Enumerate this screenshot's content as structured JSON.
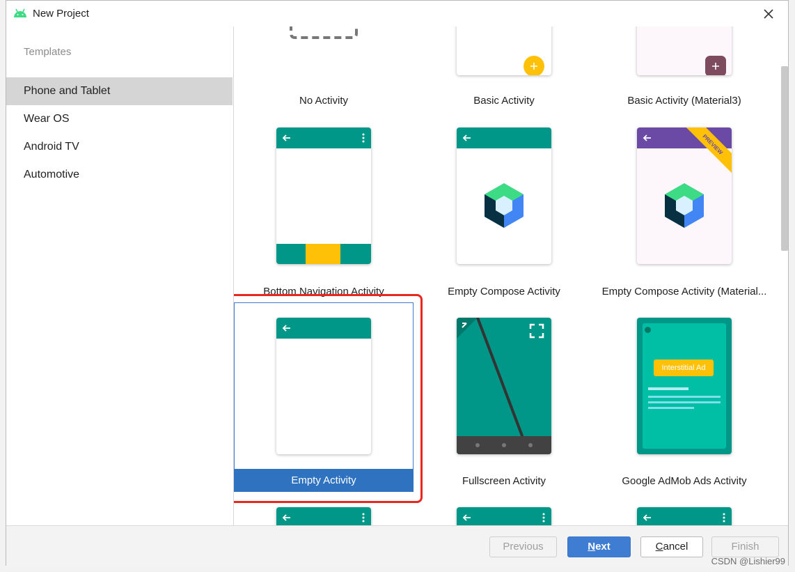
{
  "window": {
    "title": "New Project"
  },
  "sidebar": {
    "section": "Templates",
    "items": [
      {
        "label": "Phone and Tablet",
        "selected": true
      },
      {
        "label": "Wear OS",
        "selected": false
      },
      {
        "label": "Android TV",
        "selected": false
      },
      {
        "label": "Automotive",
        "selected": false
      }
    ]
  },
  "templates": {
    "row0": [
      "No Activity",
      "Basic Activity",
      "Basic Activity (Material3)"
    ],
    "row1": [
      "Bottom Navigation Activity",
      "Empty Compose Activity",
      "Empty Compose Activity (Material..."
    ],
    "row2": [
      "Empty Activity",
      "Fullscreen Activity",
      "Google AdMob Ads Activity"
    ],
    "selected": "Empty Activity",
    "preview_badge": "PREVIEW",
    "ad_label": "Interstitial Ad"
  },
  "footer": {
    "previous": "Previous",
    "next_rest": "ext",
    "next_key": "N",
    "cancel_key": "C",
    "cancel_rest": "ancel",
    "finish": "Finish"
  },
  "watermark": "CSDN @Lishier99",
  "colors": {
    "teal": "#009688",
    "purple": "#6a4aa5",
    "accent": "#2e72c0",
    "highlight": "#e8271e",
    "amber": "#ffc107"
  }
}
